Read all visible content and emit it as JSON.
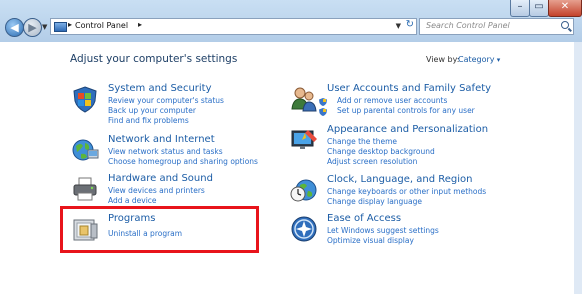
{
  "window": {
    "controls": {
      "minimize": "–",
      "maximize": "▭",
      "close": "✕"
    }
  },
  "nav": {
    "back": "◀",
    "forward": "▶",
    "dropdown": "▼"
  },
  "address": {
    "segments": [
      "Control Panel"
    ],
    "separator": "▸",
    "dropdown": "▼",
    "refresh": "↻"
  },
  "search": {
    "placeholder": "Search Control Panel"
  },
  "main": {
    "heading": "Adjust your computer's settings",
    "view_by_label": "View by:",
    "view_by_value": "Category"
  },
  "categories": [
    {
      "title": "System and Security",
      "icon": "shield-flag-icon",
      "links": [
        "Review your computer's status",
        "Back up your computer",
        "Find and fix problems"
      ]
    },
    {
      "title": "Network and Internet",
      "icon": "globe-network-icon",
      "links": [
        "View network status and tasks",
        "Choose homegroup and sharing options"
      ]
    },
    {
      "title": "Hardware and Sound",
      "icon": "printer-icon",
      "links": [
        "View devices and printers",
        "Add a device"
      ]
    },
    {
      "title": "Programs",
      "icon": "programs-box-icon",
      "links": [
        "Uninstall a program"
      ]
    },
    {
      "title": "User Accounts and Family Safety",
      "icon": "users-icon",
      "links": [
        "Add or remove user accounts",
        "Set up parental controls for any user"
      ]
    },
    {
      "title": "Appearance and Personalization",
      "icon": "monitor-paint-icon",
      "links": [
        "Change the theme",
        "Change desktop background",
        "Adjust screen resolution"
      ]
    },
    {
      "title": "Clock, Language, and Region",
      "icon": "clock-globe-icon",
      "links": [
        "Change keyboards or other input methods",
        "Change display language"
      ]
    },
    {
      "title": "Ease of Access",
      "icon": "ease-of-access-icon",
      "links": [
        "Let Windows suggest settings",
        "Optimize visual display"
      ]
    }
  ],
  "colors": {
    "link": "#2a6fc7",
    "title": "#1c5da6",
    "highlight": "#e8141b"
  }
}
